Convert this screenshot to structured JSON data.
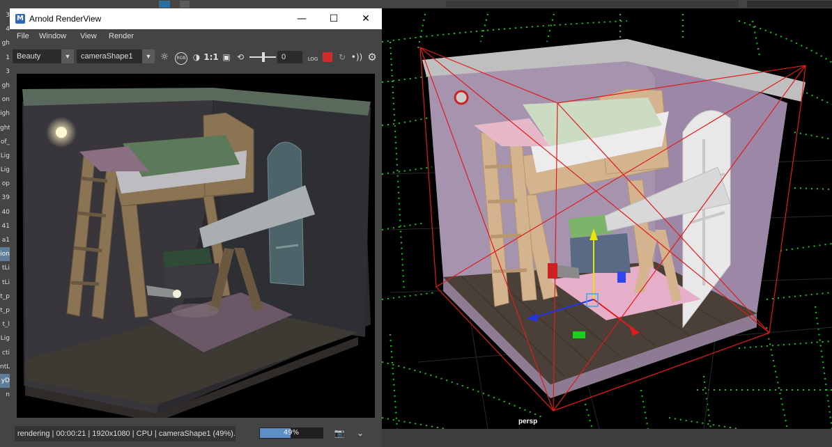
{
  "render_view": {
    "title": "Arnold RenderView",
    "window_buttons": {
      "minimize": "—",
      "maximize": "☐",
      "close": "✕"
    },
    "menus": [
      "File",
      "Window",
      "View",
      "Render"
    ],
    "toolbar": {
      "aov_value": "Beauty",
      "camera_value": "cameraShape1",
      "rgb_label": "RGB",
      "ratio_label": "1:1",
      "exposure_value": "0",
      "log_label": "LOG"
    },
    "status": {
      "text": "rendering | 00:00:21 | 1920x1080 | CPU | cameraShape1 (49%)...",
      "progress_label": "49%",
      "progress_fraction": 0.49
    }
  },
  "viewport": {
    "camera_label": "persp"
  },
  "outliner": {
    "items": [
      {
        "label": "3"
      },
      {
        "label": "4"
      },
      {
        "label": "gh"
      },
      {
        "label": "1"
      },
      {
        "label": "3"
      },
      {
        "label": "gh"
      },
      {
        "label": "on"
      },
      {
        "label": "igh"
      },
      {
        "label": "ght"
      },
      {
        "label": "of_"
      },
      {
        "label": "Lig"
      },
      {
        "label": "Lig"
      },
      {
        "label": "op"
      },
      {
        "label": "39"
      },
      {
        "label": "40"
      },
      {
        "label": "41"
      },
      {
        "label": "a1"
      },
      {
        "label": "ion",
        "selected": true
      },
      {
        "label": "tLi"
      },
      {
        "label": "tLi"
      },
      {
        "label": "t_p"
      },
      {
        "label": "t_p"
      },
      {
        "label": "t_l"
      },
      {
        "label": "Lig"
      },
      {
        "label": "cti"
      },
      {
        "label": "ntL"
      },
      {
        "label": "yD",
        "selected": true
      },
      {
        "label": "n"
      },
      {
        "label": ""
      },
      {
        "label": ""
      },
      {
        "label": ""
      }
    ]
  }
}
